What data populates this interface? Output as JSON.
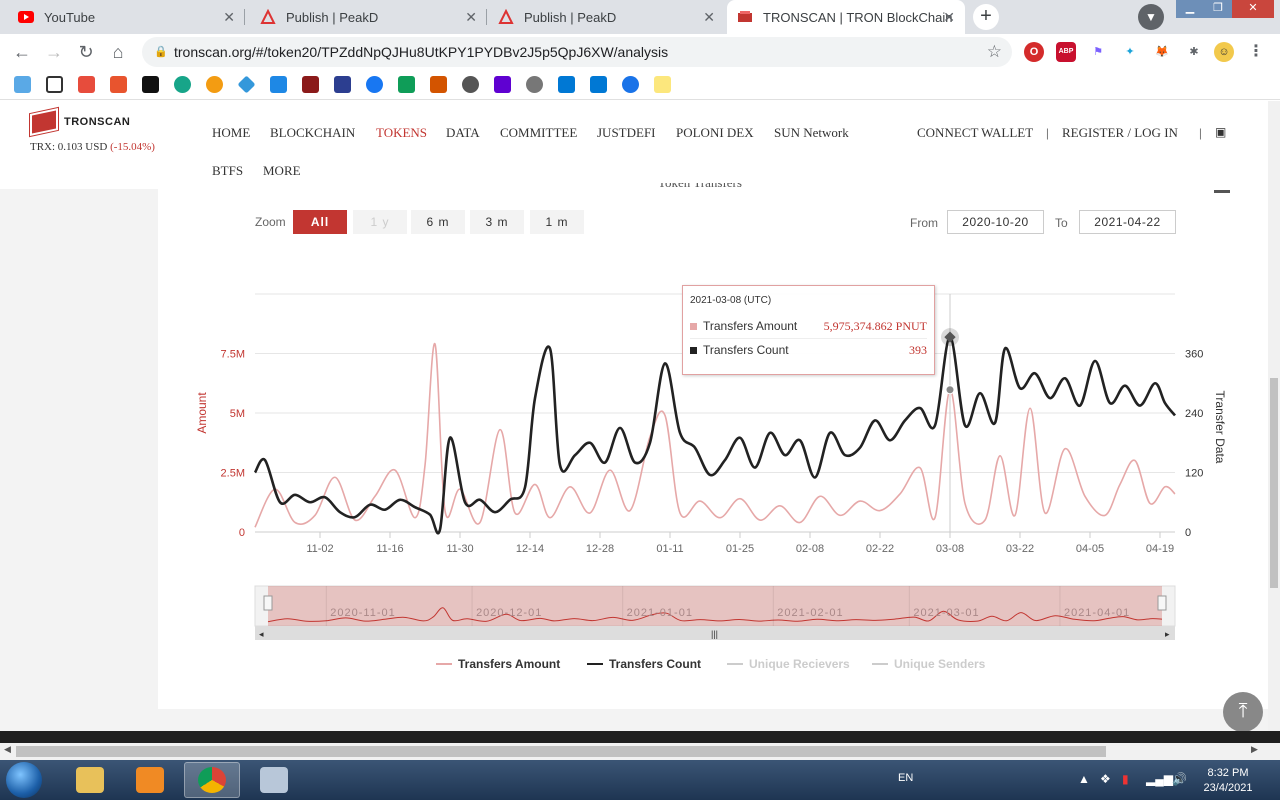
{
  "browser": {
    "tabs": [
      {
        "title": "YouTube",
        "icon": "youtube-icon"
      },
      {
        "title": "Publish | PeakD",
        "icon": "peakd-icon"
      },
      {
        "title": "Publish | PeakD",
        "icon": "peakd-icon"
      },
      {
        "title": "TRONSCAN | TRON BlockChain E",
        "icon": "tronscan-icon"
      }
    ],
    "url": "tronscan.org/#/token20/TPZddNpQJHu8UtKPY1PYDBv2J5p5QpJ6XW/analysis"
  },
  "site": {
    "logo_text": "TRONSCAN",
    "trx_price": "TRX: 0.103 USD",
    "trx_change": "(-15.04%)",
    "nav": [
      "HOME",
      "BLOCKCHAIN",
      "TOKENS",
      "DATA",
      "COMMITTEE",
      "JUSTDEFI",
      "POLONI DEX",
      "SUN Network",
      "BTFS",
      "MORE"
    ],
    "nav_active": "TOKENS",
    "connect_wallet": "CONNECT WALLET",
    "register_login": "REGISTER / LOG IN",
    "separator": "|"
  },
  "chart_panel": {
    "title": "Token Transfers",
    "zoom_label": "Zoom",
    "zoom_buttons": [
      "All",
      "1 y",
      "6 m",
      "3 m",
      "1 m"
    ],
    "zoom_active": "All",
    "from_label": "From",
    "from_date": "2020-10-20",
    "to_label": "To",
    "to_date": "2021-04-22"
  },
  "tooltip": {
    "date": "2021-03-08 (UTC)",
    "rows": [
      {
        "label": "Transfers Amount",
        "value": "5,975,374.862 PNUT",
        "color": "#e6a8a8"
      },
      {
        "label": "Transfers Count",
        "value": "393",
        "color": "#222222"
      }
    ]
  },
  "chart_data": {
    "type": "line",
    "x_ticks": [
      "11-02",
      "11-16",
      "11-30",
      "12-14",
      "12-28",
      "01-11",
      "01-25",
      "02-08",
      "02-22",
      "03-08",
      "03-22",
      "04-05",
      "04-19"
    ],
    "y_left_label": "Amount",
    "y_left_ticks": [
      "0",
      "2.5M",
      "5M",
      "7.5M"
    ],
    "y_left_range": [
      0,
      10000000
    ],
    "y_right_label": "Transfer Data",
    "y_right_ticks": [
      "0",
      "120",
      "240",
      "360"
    ],
    "y_right_range": [
      0,
      480
    ],
    "x_range": [
      "2020-10-20",
      "2021-04-22"
    ],
    "series": [
      {
        "name": "Transfers Amount",
        "color": "#e6a8a8",
        "axis": "left",
        "points": [
          [
            "2020-10-20",
            200000
          ],
          [
            "2020-10-24",
            1800000
          ],
          [
            "2020-10-28",
            400000
          ],
          [
            "2020-11-01",
            700000
          ],
          [
            "2020-11-05",
            2300000
          ],
          [
            "2020-11-09",
            500000
          ],
          [
            "2020-11-13",
            1500000
          ],
          [
            "2020-11-17",
            2600000
          ],
          [
            "2020-11-21",
            600000
          ],
          [
            "2020-11-23",
            2800000
          ],
          [
            "2020-11-25",
            7900000
          ],
          [
            "2020-11-27",
            900000
          ],
          [
            "2020-11-30",
            1800000
          ],
          [
            "2020-12-04",
            400000
          ],
          [
            "2020-12-08",
            4300000
          ],
          [
            "2020-12-11",
            800000
          ],
          [
            "2020-12-15",
            2000000
          ],
          [
            "2020-12-18",
            600000
          ],
          [
            "2020-12-22",
            1900000
          ],
          [
            "2020-12-26",
            800000
          ],
          [
            "2020-12-30",
            2600000
          ],
          [
            "2021-01-03",
            900000
          ],
          [
            "2021-01-07",
            4000000
          ],
          [
            "2021-01-10",
            4900000
          ],
          [
            "2021-01-13",
            800000
          ],
          [
            "2021-01-17",
            1300000
          ],
          [
            "2021-01-21",
            600000
          ],
          [
            "2021-01-25",
            1400000
          ],
          [
            "2021-01-29",
            500000
          ],
          [
            "2021-02-02",
            1100000
          ],
          [
            "2021-02-06",
            400000
          ],
          [
            "2021-02-10",
            1500000
          ],
          [
            "2021-02-14",
            700000
          ],
          [
            "2021-02-18",
            1300000
          ],
          [
            "2021-02-22",
            900000
          ],
          [
            "2021-02-26",
            1600000
          ],
          [
            "2021-03-02",
            2700000
          ],
          [
            "2021-03-05",
            600000
          ],
          [
            "2021-03-08",
            5975374.862
          ],
          [
            "2021-03-11",
            1200000
          ],
          [
            "2021-03-15",
            500000
          ],
          [
            "2021-03-18",
            3200000
          ],
          [
            "2021-03-21",
            700000
          ],
          [
            "2021-03-24",
            5200000
          ],
          [
            "2021-03-27",
            800000
          ],
          [
            "2021-03-31",
            3500000
          ],
          [
            "2021-04-04",
            1500000
          ],
          [
            "2021-04-08",
            700000
          ],
          [
            "2021-04-11",
            2000000
          ],
          [
            "2021-04-14",
            3000000
          ],
          [
            "2021-04-17",
            1200000
          ],
          [
            "2021-04-20",
            1900000
          ],
          [
            "2021-04-22",
            1600000
          ]
        ]
      },
      {
        "name": "Transfers Count",
        "color": "#222222",
        "axis": "right",
        "points": [
          [
            "2020-10-20",
            120
          ],
          [
            "2020-10-22",
            145
          ],
          [
            "2020-10-25",
            60
          ],
          [
            "2020-10-28",
            75
          ],
          [
            "2020-10-31",
            60
          ],
          [
            "2020-11-03",
            70
          ],
          [
            "2020-11-06",
            40
          ],
          [
            "2020-11-09",
            30
          ],
          [
            "2020-11-12",
            55
          ],
          [
            "2020-11-15",
            45
          ],
          [
            "2020-11-18",
            65
          ],
          [
            "2020-11-21",
            50
          ],
          [
            "2020-11-24",
            35
          ],
          [
            "2020-11-26",
            5
          ],
          [
            "2020-11-28",
            190
          ],
          [
            "2020-12-01",
            60
          ],
          [
            "2020-12-04",
            65
          ],
          [
            "2020-12-07",
            40
          ],
          [
            "2020-12-10",
            65
          ],
          [
            "2020-12-13",
            90
          ],
          [
            "2020-12-15",
            270
          ],
          [
            "2020-12-18",
            370
          ],
          [
            "2020-12-20",
            135
          ],
          [
            "2020-12-23",
            155
          ],
          [
            "2020-12-26",
            180
          ],
          [
            "2020-12-29",
            140
          ],
          [
            "2021-01-01",
            210
          ],
          [
            "2021-01-04",
            140
          ],
          [
            "2021-01-07",
            180
          ],
          [
            "2021-01-10",
            340
          ],
          [
            "2021-01-13",
            200
          ],
          [
            "2021-01-16",
            170
          ],
          [
            "2021-01-19",
            115
          ],
          [
            "2021-01-22",
            145
          ],
          [
            "2021-01-25",
            190
          ],
          [
            "2021-01-28",
            130
          ],
          [
            "2021-01-31",
            200
          ],
          [
            "2021-02-03",
            155
          ],
          [
            "2021-02-06",
            185
          ],
          [
            "2021-02-09",
            110
          ],
          [
            "2021-02-12",
            200
          ],
          [
            "2021-02-15",
            155
          ],
          [
            "2021-02-18",
            170
          ],
          [
            "2021-02-21",
            225
          ],
          [
            "2021-02-24",
            185
          ],
          [
            "2021-02-27",
            225
          ],
          [
            "2021-03-02",
            250
          ],
          [
            "2021-03-05",
            215
          ],
          [
            "2021-03-08",
            393
          ],
          [
            "2021-03-11",
            215
          ],
          [
            "2021-03-14",
            280
          ],
          [
            "2021-03-17",
            220
          ],
          [
            "2021-03-19",
            370
          ],
          [
            "2021-03-22",
            290
          ],
          [
            "2021-03-25",
            320
          ],
          [
            "2021-03-28",
            270
          ],
          [
            "2021-03-31",
            310
          ],
          [
            "2021-04-03",
            255
          ],
          [
            "2021-04-06",
            345
          ],
          [
            "2021-04-09",
            260
          ],
          [
            "2021-04-12",
            295
          ],
          [
            "2021-04-15",
            255
          ],
          [
            "2021-04-18",
            300
          ],
          [
            "2021-04-20",
            260
          ],
          [
            "2021-04-22",
            235
          ]
        ]
      }
    ],
    "legend": [
      {
        "name": "Transfers Amount",
        "color": "#e6a8a8",
        "visible": true
      },
      {
        "name": "Transfers Count",
        "color": "#222222",
        "visible": true
      },
      {
        "name": "Unique Recievers",
        "color": "#cccccc",
        "visible": false
      },
      {
        "name": "Unique Senders",
        "color": "#cccccc",
        "visible": false
      }
    ],
    "navigator_ticks": [
      "2020-11-01",
      "2020-12-01",
      "2021-01-01",
      "2021-02-01",
      "2021-03-01",
      "2021-04-01"
    ],
    "grid": true
  },
  "taskbar": {
    "language": "EN",
    "time": "8:32 PM",
    "date": "23/4/2021"
  }
}
